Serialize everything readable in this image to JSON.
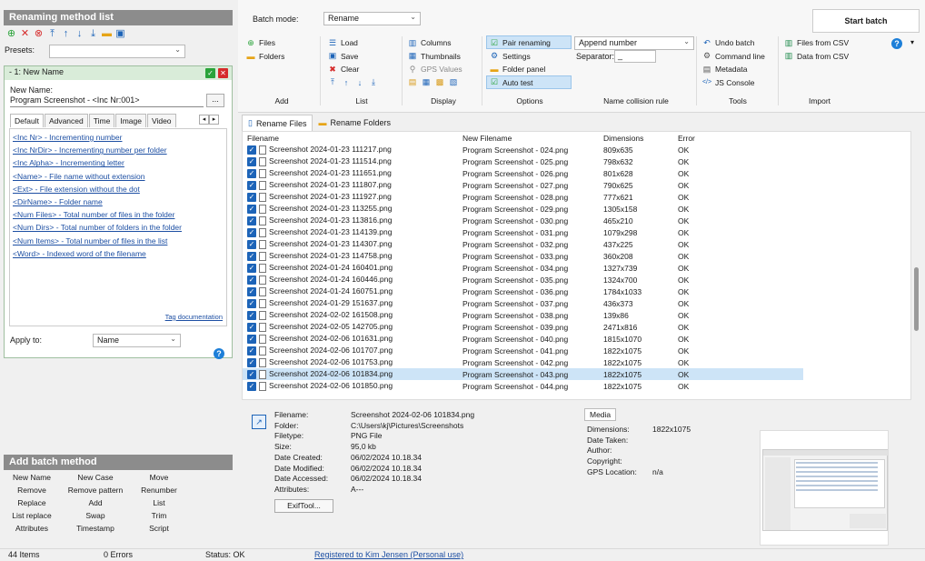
{
  "left_panel": {
    "title": "Renaming method list",
    "presets_label": "Presets:",
    "presets_value": "",
    "item_title": "- 1: New Name",
    "new_name_label": "New Name:",
    "new_name_value": "Program Screenshot - <Inc Nr:001>",
    "ellipsis_label": "...",
    "tabs": [
      "Default",
      "Advanced",
      "Time",
      "Image",
      "Video"
    ],
    "tags": [
      "<Inc Nr> - Incrementing number",
      "<Inc NrDir> - Incrementing number per folder",
      "<Inc Alpha> - Incrementing letter",
      "<Name> - File name without extension",
      "<Ext> - File extension without the dot",
      "<DirName> - Folder name",
      "<Num Files> - Total number of files in the folder",
      "<Num Dirs> - Total number of folders in the folder",
      "<Num Items> - Total number of files in the list",
      "<Word> - Indexed word of the filename"
    ],
    "tag_doc": "Tag documentation",
    "apply_to_label": "Apply to:",
    "apply_to_value": "Name",
    "help_icon": "?"
  },
  "add_batch": {
    "title": "Add batch method",
    "methods": [
      [
        "New Name",
        "New Case",
        "Move"
      ],
      [
        "Remove",
        "Remove pattern",
        "Renumber"
      ],
      [
        "Replace",
        "Add",
        "List"
      ],
      [
        "List replace",
        "Swap",
        "Trim"
      ],
      [
        "Attributes",
        "Timestamp",
        "Script"
      ]
    ]
  },
  "ribbon": {
    "batch_mode_label": "Batch mode:",
    "batch_mode_value": "Rename",
    "start_batch": "Start batch",
    "add": {
      "files": "Files",
      "folders": "Folders",
      "label": "Add"
    },
    "list": {
      "load": "Load",
      "save": "Save",
      "clear": "Clear",
      "label": "List"
    },
    "display": {
      "columns": "Columns",
      "thumbnails": "Thumbnails",
      "gps": "GPS Values",
      "label": "Display"
    },
    "options": {
      "pair": "Pair renaming",
      "settings": "Settings",
      "folder_panel": "Folder panel",
      "auto_test": "Auto test",
      "label": "Options"
    },
    "collision": {
      "value": "Append number",
      "separator_label": "Separator:",
      "separator_value": "_",
      "label": "Name collision rule"
    },
    "tools": {
      "undo": "Undo batch",
      "cmd": "Command line",
      "metadata": "Metadata",
      "js": "JS Console",
      "label": "Tools"
    },
    "import": {
      "csv_files": "Files from CSV",
      "csv_data": "Data from CSV",
      "label": "Import"
    }
  },
  "main_tabs": [
    "Rename Files",
    "Rename Folders"
  ],
  "table": {
    "headers": [
      "Filename",
      "New Filename",
      "Dimensions",
      "Error"
    ],
    "rows": [
      [
        "Screenshot 2024-01-23 111217.png",
        "Program Screenshot - 024.png",
        "809x635",
        "OK"
      ],
      [
        "Screenshot 2024-01-23 111514.png",
        "Program Screenshot - 025.png",
        "798x632",
        "OK"
      ],
      [
        "Screenshot 2024-01-23 111651.png",
        "Program Screenshot - 026.png",
        "801x628",
        "OK"
      ],
      [
        "Screenshot 2024-01-23 111807.png",
        "Program Screenshot - 027.png",
        "790x625",
        "OK"
      ],
      [
        "Screenshot 2024-01-23 111927.png",
        "Program Screenshot - 028.png",
        "777x621",
        "OK"
      ],
      [
        "Screenshot 2024-01-23 113255.png",
        "Program Screenshot - 029.png",
        "1305x158",
        "OK"
      ],
      [
        "Screenshot 2024-01-23 113816.png",
        "Program Screenshot - 030.png",
        "465x210",
        "OK"
      ],
      [
        "Screenshot 2024-01-23 114139.png",
        "Program Screenshot - 031.png",
        "1079x298",
        "OK"
      ],
      [
        "Screenshot 2024-01-23 114307.png",
        "Program Screenshot - 032.png",
        "437x225",
        "OK"
      ],
      [
        "Screenshot 2024-01-23 114758.png",
        "Program Screenshot - 033.png",
        "360x208",
        "OK"
      ],
      [
        "Screenshot 2024-01-24 160401.png",
        "Program Screenshot - 034.png",
        "1327x739",
        "OK"
      ],
      [
        "Screenshot 2024-01-24 160446.png",
        "Program Screenshot - 035.png",
        "1324x700",
        "OK"
      ],
      [
        "Screenshot 2024-01-24 160751.png",
        "Program Screenshot - 036.png",
        "1784x1033",
        "OK"
      ],
      [
        "Screenshot 2024-01-29 151637.png",
        "Program Screenshot - 037.png",
        "436x373",
        "OK"
      ],
      [
        "Screenshot 2024-02-02 161508.png",
        "Program Screenshot - 038.png",
        "139x86",
        "OK"
      ],
      [
        "Screenshot 2024-02-05 142705.png",
        "Program Screenshot - 039.png",
        "2471x816",
        "OK"
      ],
      [
        "Screenshot 2024-02-06 101631.png",
        "Program Screenshot - 040.png",
        "1815x1070",
        "OK"
      ],
      [
        "Screenshot 2024-02-06 101707.png",
        "Program Screenshot - 041.png",
        "1822x1075",
        "OK"
      ],
      [
        "Screenshot 2024-02-06 101753.png",
        "Program Screenshot - 042.png",
        "1822x1075",
        "OK"
      ],
      [
        "Screenshot 2024-02-06 101834.png",
        "Program Screenshot - 043.png",
        "1822x1075",
        "OK"
      ],
      [
        "Screenshot 2024-02-06 101850.png",
        "Program Screenshot - 044.png",
        "1822x1075",
        "OK"
      ]
    ]
  },
  "file_info": {
    "labels": [
      "Filename:",
      "Folder:",
      "Filetype:",
      "Size:",
      "Date Created:",
      "Date Modified:",
      "Date Accessed:",
      "Attributes:"
    ],
    "values": [
      "Screenshot 2024-02-06 101834.png",
      "C:\\Users\\kj\\Pictures\\Screenshots",
      "PNG File",
      "95,0 kb",
      "06/02/2024 10.18.34",
      "06/02/2024 10.18.34",
      "06/02/2024 10.18.34",
      "A---"
    ],
    "exiftool": "ExifTool..."
  },
  "media": {
    "tab": "Media",
    "labels": [
      "Dimensions:",
      "Date Taken:",
      "Author:",
      "Copyright:",
      "GPS Location:"
    ],
    "values": [
      "1822x1075",
      "",
      "",
      "",
      "n/a"
    ]
  },
  "status": {
    "items": "44 Items",
    "errors": "0 Errors",
    "status": "Status: OK",
    "registered": "Registered to Kim Jensen (Personal use)"
  }
}
